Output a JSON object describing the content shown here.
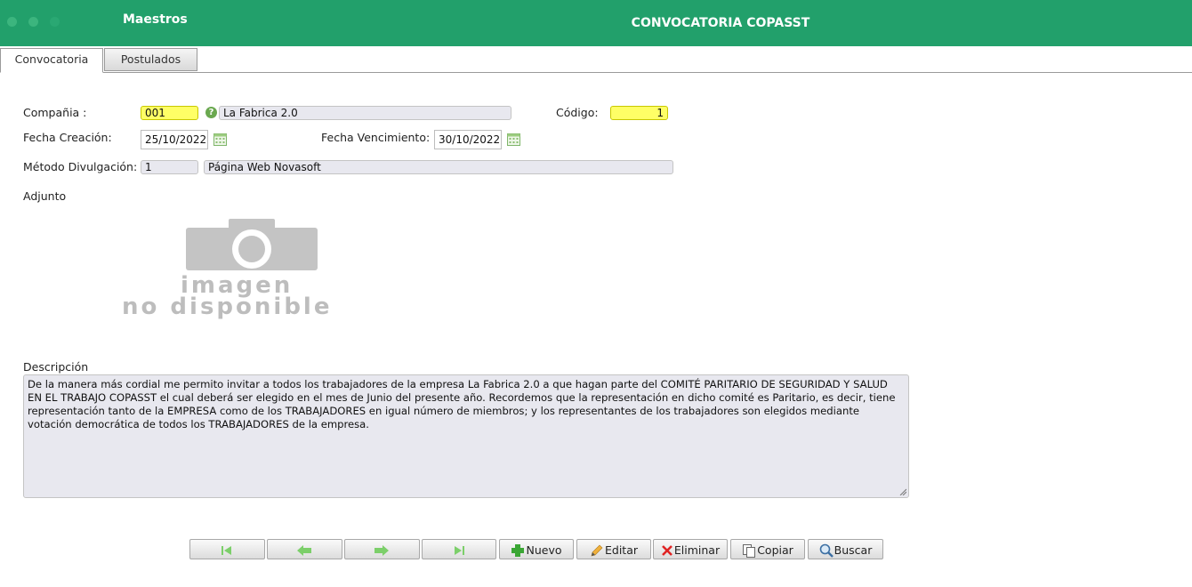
{
  "header": {
    "brand": "Maestros",
    "title": "CONVOCATORIA COPASST"
  },
  "tabs": [
    {
      "label": "Convocatoria",
      "active": true
    },
    {
      "label": "Postulados",
      "active": false
    }
  ],
  "form": {
    "company_label": "Compañia :",
    "company_code": "001",
    "company_name": "La Fabrica 2.0",
    "code_label": "Código:",
    "code_value": "1",
    "creation_label": "Fecha Creación:",
    "creation_date": "25/10/2022",
    "expiry_label": "Fecha Vencimiento:",
    "expiry_date": "30/10/2022",
    "method_label": "Método Divulgación:",
    "method_code": "1",
    "method_name": "Página Web Novasoft",
    "attachment_label": "Adjunto",
    "image_placeholder_line1": "imagen",
    "image_placeholder_line2": "no disponible",
    "description_label": "Descripción",
    "description": "De la manera más cordial me permito invitar a todos los trabajadores de la empresa  La Fabrica 2.0 a que hagan parte del COMITÉ PARITARIO DE SEGURIDAD Y SALUD EN EL TRABAJO COPASST el cual deberá ser elegido en el mes de Junio del presente año. Recordemos que la representación en dicho comité es Paritario, es decir, tiene representación tanto de la EMPRESA como de los TRABAJADORES en igual número de miembros; y los representantes de los trabajadores son elegidos mediante votación democrática de todos los TRABAJADORES de la empresa."
  },
  "toolbar": {
    "new_label": "Nuevo",
    "edit_label": "Editar",
    "delete_label": "Eliminar",
    "copy_label": "Copiar",
    "search_label": "Buscar"
  },
  "colors": {
    "header": "#22a06b",
    "required_field": "#ffff66",
    "readonly_field": "#e8e8ef"
  }
}
